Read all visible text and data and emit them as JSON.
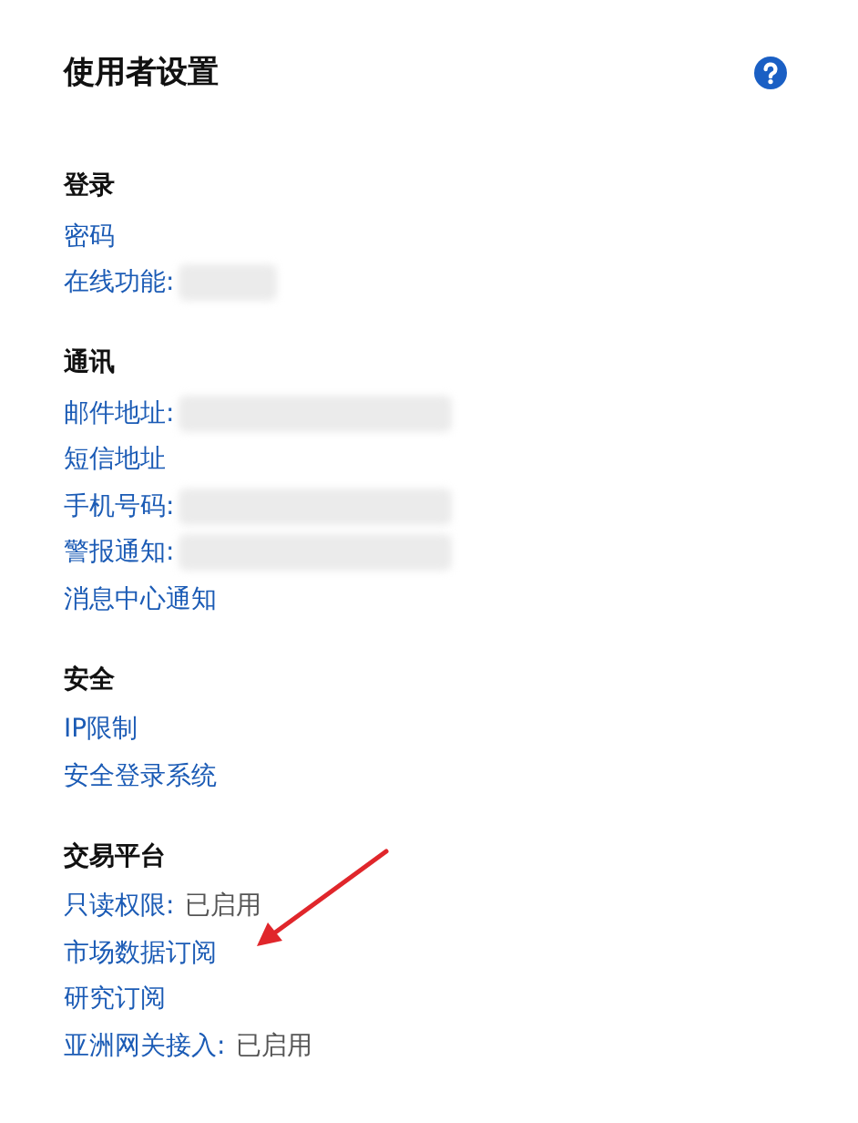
{
  "title": "使用者设置",
  "sections": [
    {
      "heading": "登录",
      "items": [
        {
          "label": "密码"
        },
        {
          "label": "在线功能:",
          "redacted": true,
          "redaction_wide": false
        }
      ]
    },
    {
      "heading": "通讯",
      "items": [
        {
          "label": "邮件地址:",
          "redacted": true,
          "redaction_wide": true
        },
        {
          "label": "短信地址"
        },
        {
          "label": "手机号码:",
          "redacted": true,
          "redaction_wide": true
        },
        {
          "label": "警报通知:",
          "redacted": true,
          "redaction_wide": true
        },
        {
          "label": "消息中心通知"
        }
      ]
    },
    {
      "heading": "安全",
      "items": [
        {
          "label": "IP限制"
        },
        {
          "label": "安全登录系统"
        }
      ]
    },
    {
      "heading": "交易平台",
      "items": [
        {
          "label": "只读权限:",
          "value": "已启用"
        },
        {
          "label": "市场数据订阅",
          "annotated": true
        },
        {
          "label": "研究订阅"
        },
        {
          "label": "亚洲网关接入:",
          "value": "已启用"
        }
      ]
    }
  ]
}
